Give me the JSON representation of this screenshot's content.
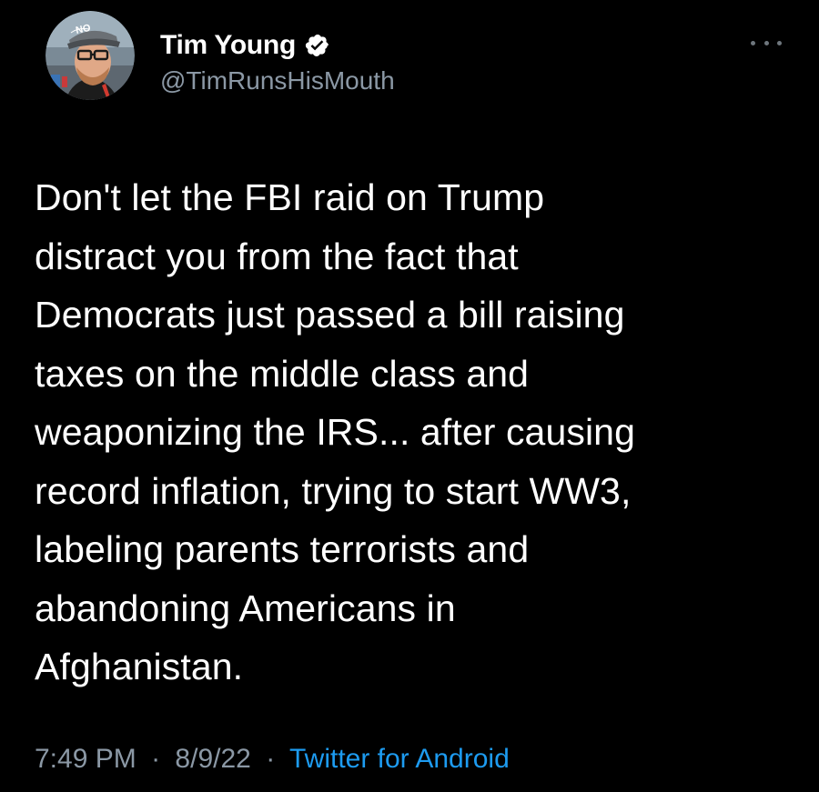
{
  "tweet": {
    "author": {
      "display_name": "Tim Young",
      "handle": "@TimRunsHisMouth",
      "verified": true,
      "avatar_icon": "profile-photo",
      "hat_text": "NO"
    },
    "more_icon": "ellipsis-icon",
    "text": "Don't let the FBI raid on Trump\ndistract you from the fact that\nDemocrats just passed a bill raising\ntaxes on the middle class and\nweaponizing the IRS... after causing\nrecord inflation, trying to start WW3,\nlabeling parents terrorists and\nabandoning Americans in\nAfghanistan.",
    "time": "7:49 PM",
    "date": "8/9/22",
    "separator": "·",
    "source": "Twitter for Android"
  },
  "colors": {
    "background": "#000000",
    "text": "#ffffff",
    "secondary_text": "#8b98a5",
    "link": "#1d9bf0",
    "verified_badge": "#ffffff"
  }
}
